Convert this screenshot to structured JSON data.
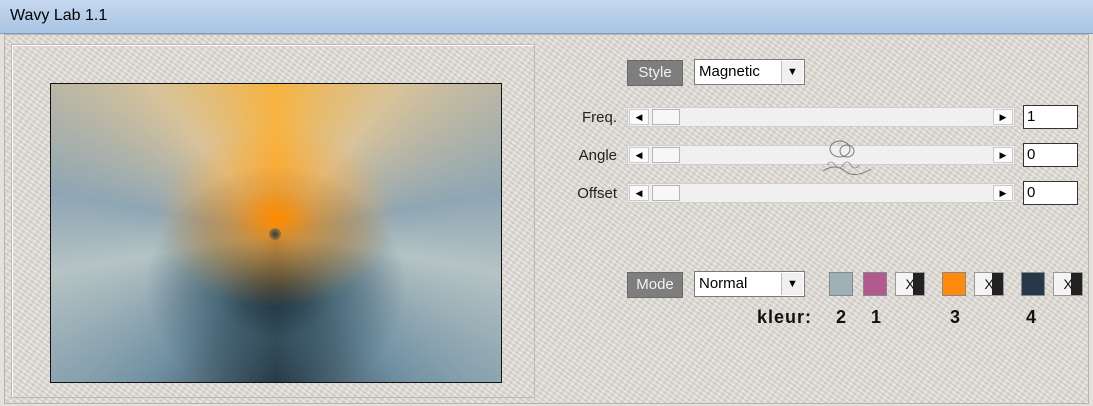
{
  "window": {
    "title": "Wavy Lab 1.1"
  },
  "style": {
    "label": "Style",
    "value": "Magnetic"
  },
  "params": [
    {
      "label": "Freq.",
      "value": "1"
    },
    {
      "label": "Angle",
      "value": "0"
    },
    {
      "label": "Offset",
      "value": "0"
    }
  ],
  "mode": {
    "label": "Mode",
    "value": "Normal"
  },
  "colors": {
    "swatch2": "#9fb1b7",
    "swatch1": "#b25a90",
    "swatch3": "#ff8a0c",
    "swatch4": "#27384a"
  },
  "kleur": {
    "label": "kleur:",
    "n2": "2",
    "n1": "1",
    "n3": "3",
    "n4": "4"
  },
  "swap_label": "X",
  "watermark": "CarlORA"
}
